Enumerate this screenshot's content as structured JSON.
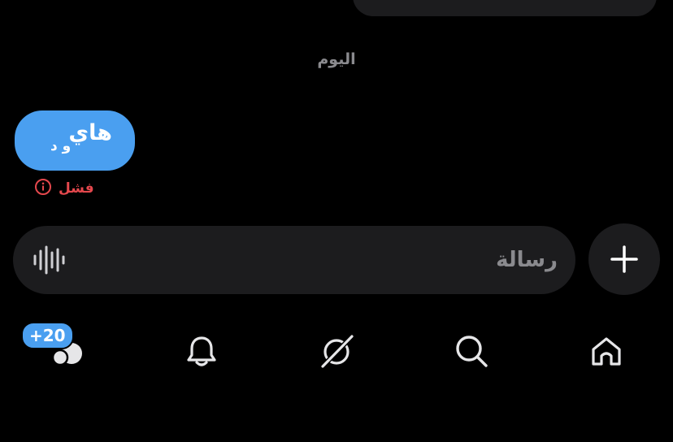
{
  "conversation": {
    "date_separator": "اليوم",
    "message": {
      "text": "هاي",
      "meta": "و د",
      "status": "فشل",
      "status_icon": "info-icon"
    }
  },
  "composer": {
    "placeholder": "رسالة",
    "value": "",
    "voice_icon": "waveform-icon",
    "add_icon": "plus-icon"
  },
  "bottom_nav": {
    "items": [
      {
        "name": "messages",
        "icon": "messages-icon",
        "badge": "+20"
      },
      {
        "name": "notifications",
        "icon": "bell-icon"
      },
      {
        "name": "grok",
        "icon": "grok-icon"
      },
      {
        "name": "search",
        "icon": "search-icon"
      },
      {
        "name": "home",
        "icon": "home-icon"
      }
    ]
  },
  "colors": {
    "background": "#000000",
    "bubble_sent": "#4a9ff0",
    "surface": "#1c1c1e",
    "error": "#e5484d",
    "muted_text": "#8a8a8e"
  }
}
